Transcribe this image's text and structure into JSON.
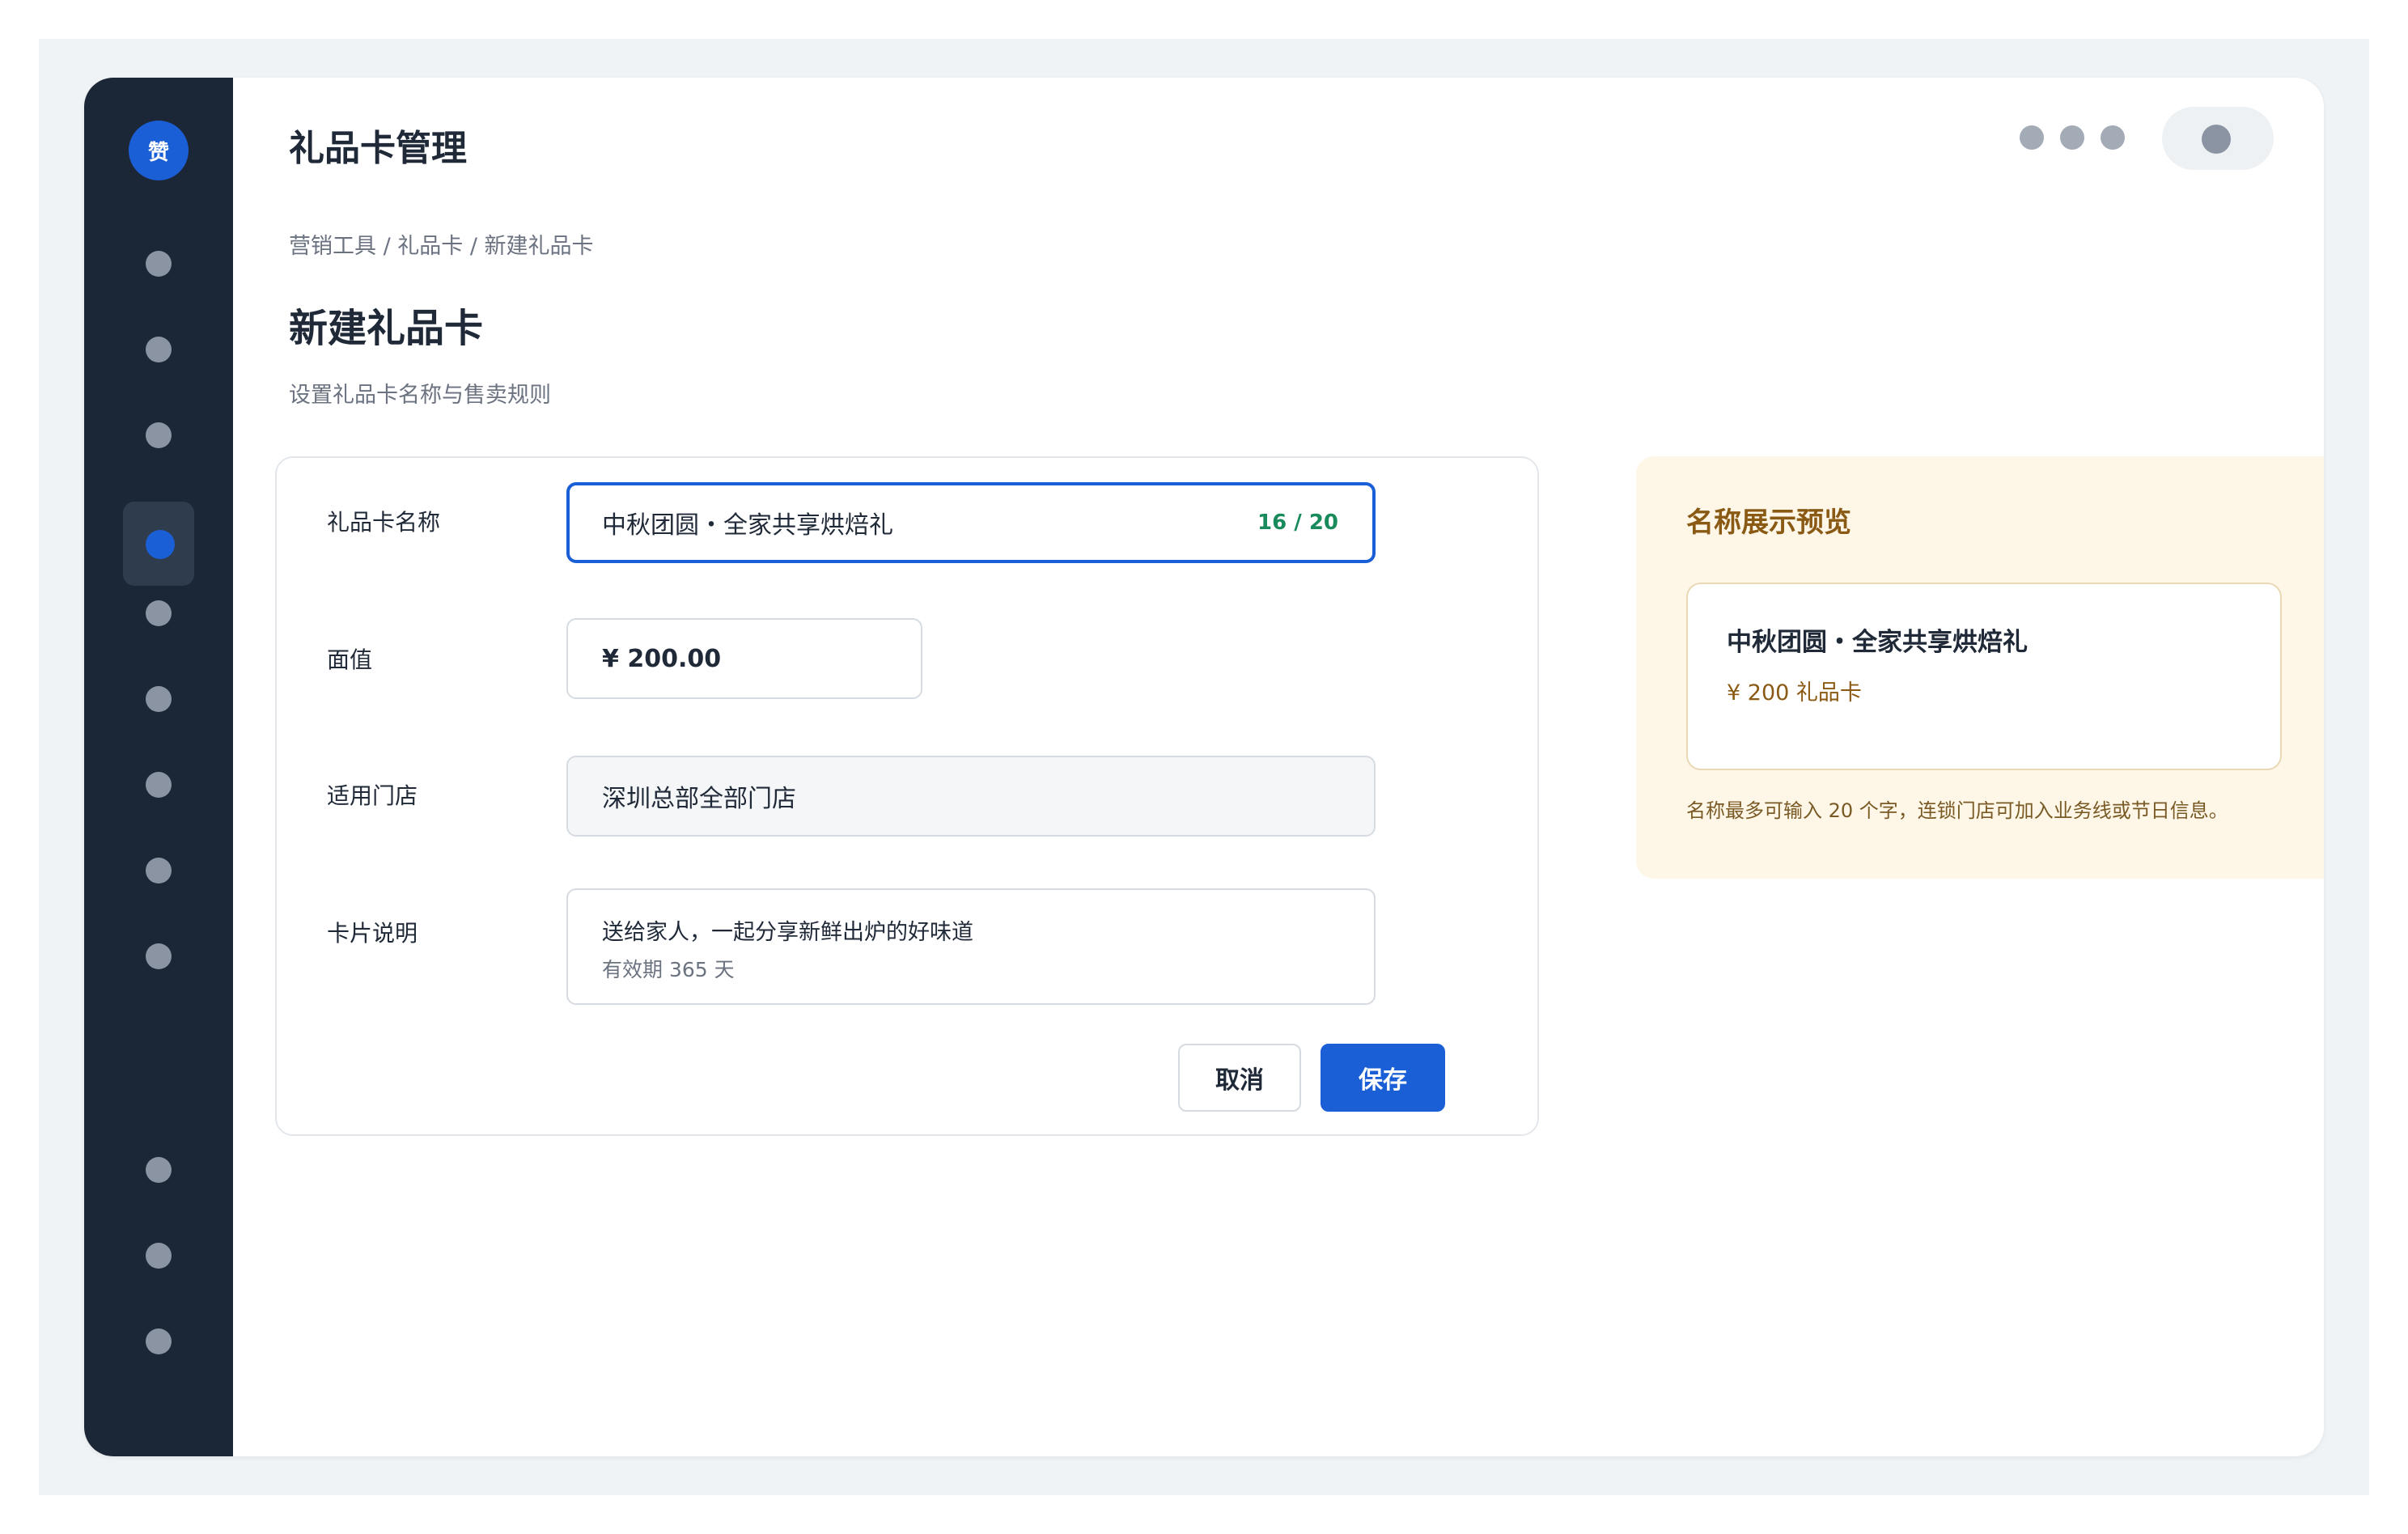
{
  "app": {
    "logo_text": "赞",
    "title": "礼品卡管理"
  },
  "breadcrumb": "营销工具 / 礼品卡 / 新建礼品卡",
  "page": {
    "title": "新建礼品卡",
    "subtitle": "设置礼品卡名称与售卖规则"
  },
  "form": {
    "name": {
      "label": "礼品卡名称",
      "value": "中秋团圆・全家共享烘焙礼",
      "counter": "16 / 20"
    },
    "face_value": {
      "label": "面值",
      "value": "¥ 200.00"
    },
    "stores": {
      "label": "适用门店",
      "value": "深圳总部全部门店"
    },
    "description": {
      "label": "卡片说明",
      "line1": "送给家人，一起分享新鲜出炉的好味道",
      "line2": "有效期 365 天"
    },
    "cancel_label": "取消",
    "save_label": "保存"
  },
  "preview": {
    "title": "名称展示预览",
    "card_name": "中秋团圆・全家共享烘焙礼",
    "card_sub": "¥ 200 礼品卡",
    "hint": "名称最多可输入 20 个字，连锁门店可加入业务线或节日信息。"
  },
  "colors": {
    "accent": "#1a5fd6",
    "sidebar": "#1b2636",
    "counter_ok": "#198a5b",
    "preview_bg": "#fef7e8",
    "preview_text": "#8a5a14"
  },
  "icons": {
    "logo": "brand-logo",
    "nav": "nav-dot-icon",
    "window_controls": "more-dots-icon",
    "avatar": "user-avatar-icon"
  }
}
